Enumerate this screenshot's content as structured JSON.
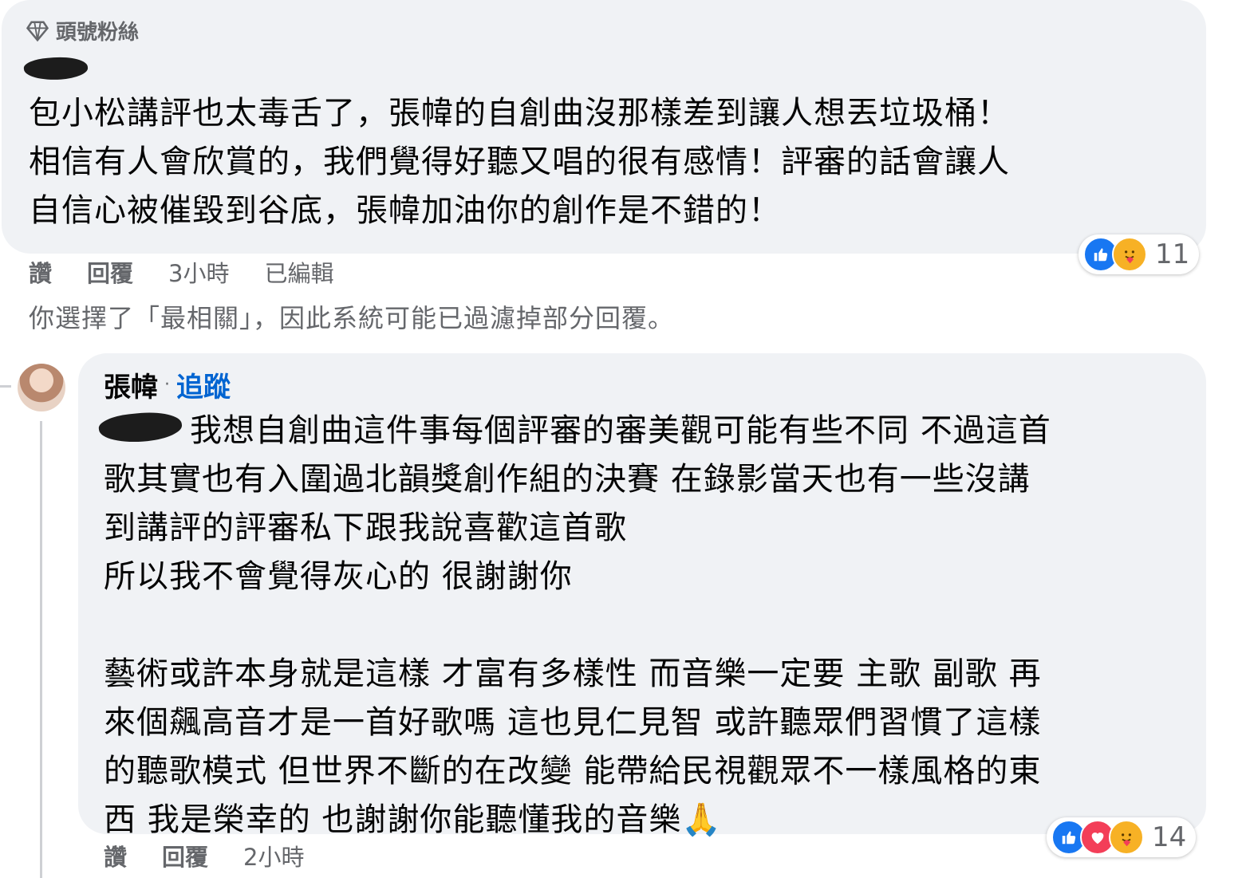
{
  "comment1": {
    "badge_label": "頭號粉絲",
    "lines": [
      "包小松講評也太毒舌了，張幃的自創曲沒那樣差到讓人想丟垃圾桶！",
      "相信有人會欣賞的，我們覺得好聽又唱的很有感情！評審的話會讓人",
      "自信心被催毀到谷底，張幃加油你的創作是不錯的！"
    ],
    "actions": {
      "like": "讚",
      "reply": "回覆",
      "time": "3小時",
      "edited": "已編輯"
    },
    "reactions": {
      "icons": [
        "like-icon",
        "care-icon"
      ],
      "count": "11"
    }
  },
  "filter_note": "你選擇了「最相關」，因此系統可能已過濾掉部分回覆。",
  "reply": {
    "author": "張幃",
    "separator": "·",
    "follow_label": "追蹤",
    "lines": [
      "我想自創曲這件事每個評審的審美觀可能有些不同 不過這首",
      "歌其實也有入圍過北韻獎創作組的決賽 在錄影當天也有一些沒講",
      "到講評的評審私下跟我說喜歡這首歌",
      "所以我不會覺得灰心的 很謝謝你",
      "",
      "藝術或許本身就是這樣 才富有多樣性 而音樂一定要 主歌 副歌 再",
      "來個飆高音才是一首好歌嗎 這也見仁見智 或許聽眾們習慣了這樣",
      "的聽歌模式 但世界不斷的在改變 能帶給民視觀眾不一樣風格的東",
      "西 我是榮幸的 也謝謝你能聽懂我的音樂🙏"
    ],
    "actions": {
      "like": "讚",
      "reply": "回覆",
      "time": "2小時"
    },
    "reactions": {
      "icons": [
        "like-icon",
        "love-icon",
        "care-icon"
      ],
      "count": "14"
    }
  }
}
